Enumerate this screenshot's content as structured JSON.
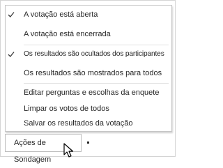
{
  "menu": {
    "items": [
      {
        "label": "A votação está aberta",
        "checked": true
      },
      {
        "label": "A votação está encerrada",
        "checked": false
      },
      {
        "label": "Os resultados são ocultados dos participantes",
        "checked": true
      },
      {
        "label": "Os resultados são mostrados para todos",
        "checked": false
      },
      {
        "label": "Editar perguntas e escolhas da enquete",
        "checked": false
      },
      {
        "label": "Limpar os votos de todos",
        "checked": false
      },
      {
        "label": "Salvar os resultados da votação",
        "checked": false
      }
    ]
  },
  "trigger": {
    "label": "Ações de Sondagem"
  },
  "icons": {
    "check": "checkmark-icon",
    "caret": "caret-down-icon",
    "cursor": "mouse-pointer-icon"
  }
}
